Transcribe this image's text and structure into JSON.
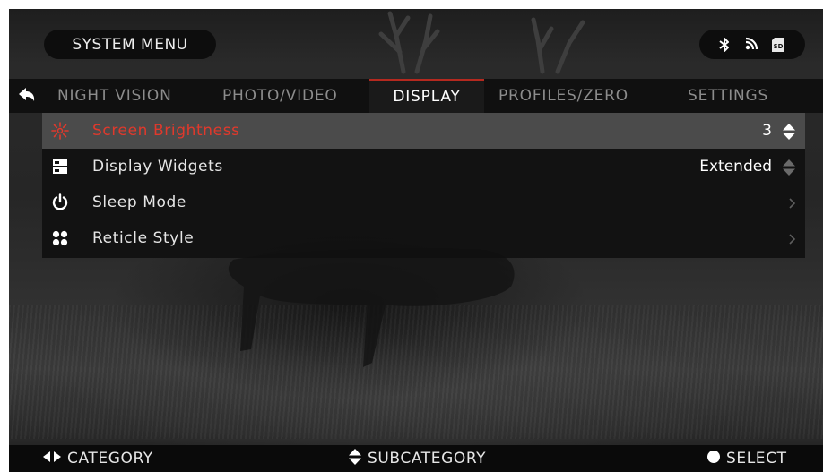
{
  "header": {
    "title": "SYSTEM MENU",
    "status_icons": [
      "bluetooth-icon",
      "wifi-icon",
      "sd-card-icon"
    ],
    "sd_label": "SD"
  },
  "tabs": [
    {
      "label": "NIGHT VISION",
      "active": false
    },
    {
      "label": "PHOTO/VIDEO",
      "active": false
    },
    {
      "label": "DISPLAY",
      "active": true
    },
    {
      "label": "PROFILES/ZERO",
      "active": false
    },
    {
      "label": "SETTINGS",
      "active": false
    }
  ],
  "items": [
    {
      "label": "Screen Brightness",
      "value": "3",
      "icon": "brightness-icon",
      "selected": true,
      "control": "up-down"
    },
    {
      "label": "Display Widgets",
      "value": "Extended",
      "icon": "widgets-icon",
      "selected": false,
      "control": "up-down"
    },
    {
      "label": "Sleep Mode",
      "value": "",
      "icon": "power-icon",
      "selected": false,
      "control": "chevron"
    },
    {
      "label": "Reticle Style",
      "value": "",
      "icon": "reticle-icon",
      "selected": false,
      "control": "chevron"
    }
  ],
  "footer": {
    "category": "CATEGORY",
    "subcategory": "SUBCATEGORY",
    "select": "SELECT"
  },
  "colors": {
    "accent_red": "#e0392c",
    "tab_underline": "#b5291f",
    "selected_row": "#4b4b4b"
  }
}
